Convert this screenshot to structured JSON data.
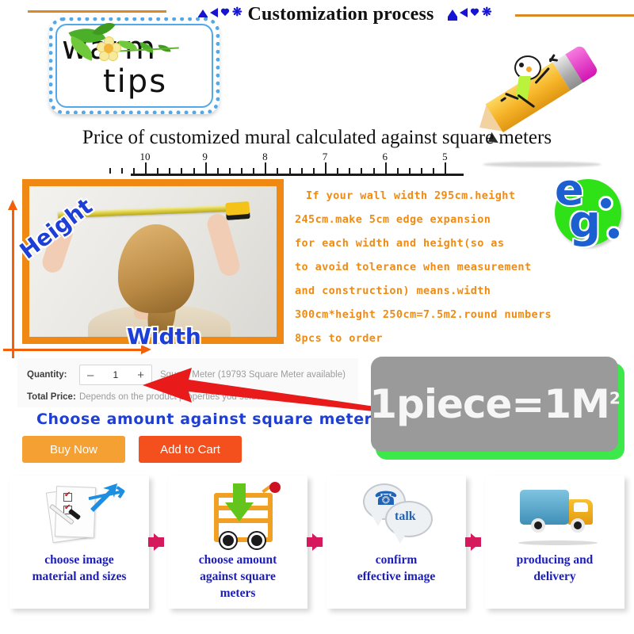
{
  "header": {
    "title": "Customization process",
    "symbols": [
      "pentagon-icon",
      "triangle-icon",
      "heart-icon",
      "star-icon"
    ]
  },
  "warm_tips": {
    "line1": "warm",
    "line2": "tips"
  },
  "subtitle": "Price of customized mural calculated against square meters",
  "ruler": {
    "labels": [
      "10",
      "9",
      "8",
      "7",
      "6",
      "5"
    ]
  },
  "photo": {
    "height_label": "Height",
    "width_label": "Width",
    "alt": "woman-measuring-wall-photo"
  },
  "info_text": {
    "lines": [
      "If your wall width 295cm.height",
      "245cm.make 5cm edge expansion",
      "for each width and height(so as",
      "to avoid tolerance when measurement",
      "and construction) means.width",
      "300cm*height 250cm=7.5m2.round numbers",
      "8pcs to order"
    ]
  },
  "eg_badge": {
    "letter1": "e",
    "letter2": "g"
  },
  "form": {
    "quantity_label": "Quantity:",
    "minus": "–",
    "quantity_value": "1",
    "plus": "+",
    "availability": "Square Meter (19793 Square Meter available)",
    "total_price_label": "Total Price:",
    "total_price_value": "Depends on the product properties you select",
    "choose_note": "Choose amount against square meters",
    "buy_now": "Buy Now",
    "add_to_cart": "Add to Cart"
  },
  "piece_box": {
    "text": "1piece=1M",
    "superscript": "2"
  },
  "steps": [
    {
      "label": "choose image\nmaterial and sizes",
      "icon": "documents-checklist-icon"
    },
    {
      "label": "choose amount\nagainst square\nmeters",
      "icon": "shopping-cart-icon"
    },
    {
      "label": "confirm\neffective image",
      "icon": "talk-bubbles-icon"
    },
    {
      "label": "producing and\ndelivery",
      "icon": "delivery-truck-icon"
    }
  ],
  "colors": {
    "orange_accent": "#ef8b14",
    "blue_text": "#1d3fd8",
    "buy_now": "#f5a032",
    "add_to_cart": "#f4501e",
    "green_badge": "#2fe117",
    "pink_arrow": "#d6185c",
    "red_pointer": "#e81a1a"
  }
}
